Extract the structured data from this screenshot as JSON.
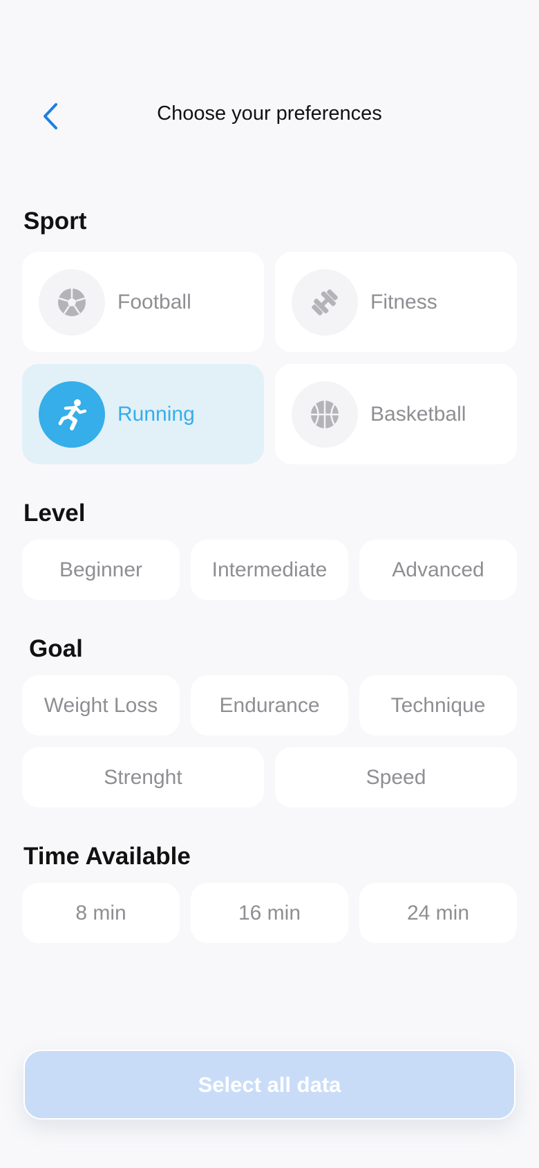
{
  "header": {
    "title": "Choose your preferences"
  },
  "sections": {
    "sport": "Sport",
    "level": "Level",
    "goal": "Goal",
    "time": "Time Available"
  },
  "sports": [
    {
      "label": "Football",
      "icon": "soccer-ball-icon",
      "selected": false
    },
    {
      "label": "Fitness",
      "icon": "dumbbell-icon",
      "selected": false
    },
    {
      "label": "Running",
      "icon": "runner-icon",
      "selected": true
    },
    {
      "label": "Basketball",
      "icon": "basketball-icon",
      "selected": false
    }
  ],
  "levels": [
    "Beginner",
    "Intermediate",
    "Advanced"
  ],
  "goals": [
    "Weight Loss",
    "Endurance",
    "Technique",
    "Strenght",
    "Speed"
  ],
  "times": [
    "8 min",
    "16 min",
    "24 min"
  ],
  "cta": {
    "label": "Select all data"
  },
  "colors": {
    "accent": "#35aee9",
    "back": "#1a7fe6",
    "selected_bg": "#e2f0f8",
    "cta_bg": "#c9dcf7",
    "muted_text": "#8e8e93"
  }
}
